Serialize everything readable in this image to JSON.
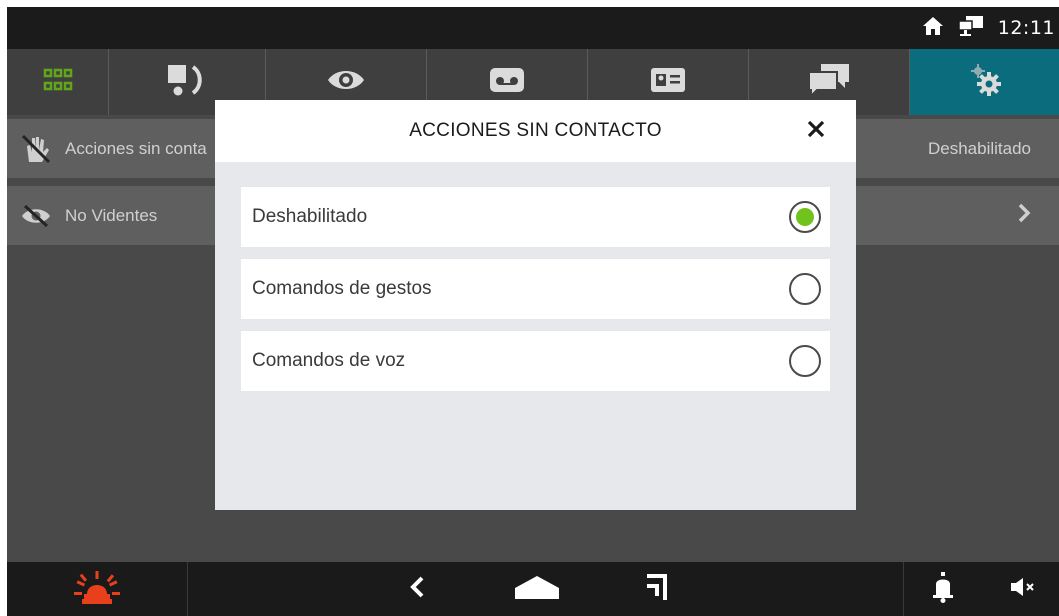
{
  "status_bar": {
    "time": "12:11",
    "icons": [
      "home-icon",
      "network-icon"
    ]
  },
  "tabs": [
    {
      "icon": "apps-grid-icon",
      "active": false
    },
    {
      "icon": "intercom-handset-icon",
      "active": false
    },
    {
      "icon": "eye-icon",
      "active": false
    },
    {
      "icon": "voicemail-icon",
      "active": false
    },
    {
      "icon": "contact-card-icon",
      "active": false
    },
    {
      "icon": "chat-icon",
      "active": false
    },
    {
      "icon": "settings-gears-icon",
      "active": true
    }
  ],
  "settings_list": [
    {
      "icon": "touchless-hand-icon",
      "label": "Acciones sin conta",
      "value": "Deshabilitado"
    },
    {
      "icon": "eye-off-icon",
      "label": "No Videntes",
      "value": ""
    }
  ],
  "dialog": {
    "title": "ACCIONES SIN CONTACTO",
    "close_icon": "close-icon",
    "options": [
      {
        "label": "Deshabilitado",
        "selected": true
      },
      {
        "label": "Comandos de gestos",
        "selected": false
      },
      {
        "label": "Comandos de voz",
        "selected": false
      }
    ]
  },
  "nav_bar": {
    "buttons": [
      "alarm-siren-icon",
      "back-icon",
      "home-icon",
      "hang-up-icon",
      "bell-icon",
      "speaker-mute-icon"
    ]
  },
  "colors": {
    "accent_active_tab": "#0c7e92",
    "selected_radio": "#71c21d",
    "alarm_icon": "#e8401c"
  }
}
